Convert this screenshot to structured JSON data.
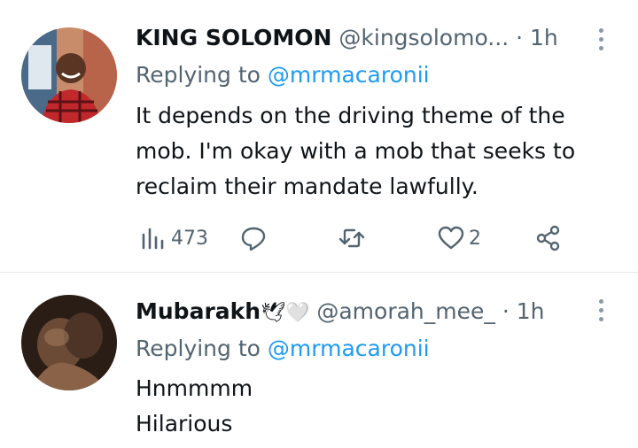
{
  "colors": {
    "text": "#0f1419",
    "muted": "#536471",
    "accent": "#1d9bf0",
    "divider": "#e6e9eb"
  },
  "tweets": [
    {
      "display_name": "KING SOLOMON",
      "display_emoji": "",
      "handle": "@kingsolomo...",
      "dot": "·",
      "time": "1h",
      "replying_prefix": "Replying to",
      "replying_to": "@mrmacaronii",
      "text_lines": [
        "It depends on the driving theme of the",
        "mob. I'm okay with a mob that seeks to",
        "reclaim their mandate lawfully."
      ],
      "views": "473",
      "likes": "2",
      "icons": {
        "views": "analytics-icon",
        "reply": "reply-icon",
        "retweet": "retweet-icon",
        "like": "heart-icon",
        "share": "share-icon",
        "more": "more-options-icon"
      }
    },
    {
      "display_name": "Mubarakh",
      "display_emoji": "🕊🤍",
      "handle": "@amorah_mee_",
      "dot": "·",
      "time": "1h",
      "replying_prefix": "Replying to",
      "replying_to": "@mrmacaronii",
      "text_lines": [
        "Hnmmmm",
        "Hilarious"
      ],
      "icons": {
        "more": "more-options-icon"
      }
    }
  ]
}
